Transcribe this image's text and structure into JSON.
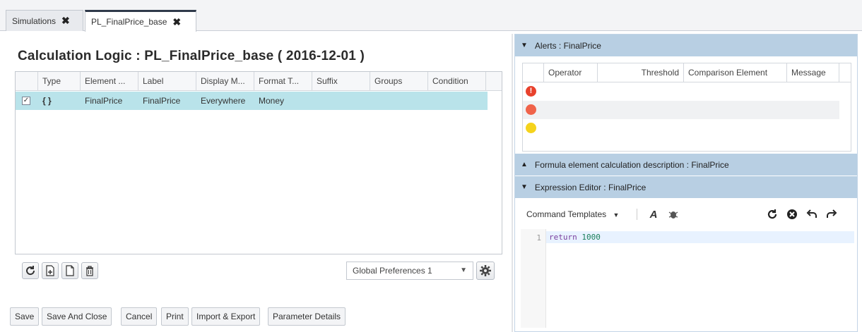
{
  "tabs": [
    {
      "label": "Simulations",
      "close": "✖"
    },
    {
      "label": "PL_FinalPrice_base",
      "close": "✖"
    }
  ],
  "left": {
    "title": "Calculation Logic : PL_FinalPrice_base ( 2016-12-01 )",
    "columns": [
      "Type",
      "Element ...",
      "Label",
      "Display M...",
      "Format T...",
      "Suffix",
      "Groups",
      "Condition"
    ],
    "row": {
      "checked": "✓",
      "type": "{ }",
      "element": "FinalPrice",
      "label": "FinalPrice",
      "display": "Everywhere",
      "format": "Money"
    },
    "preferences_select": "Global Preferences 1",
    "buttons": [
      "Save",
      "Save And Close",
      "Cancel",
      "Print",
      "Import & Export",
      "Parameter Details"
    ]
  },
  "right": {
    "alerts_title": "Alerts : FinalPrice",
    "alerts_columns": [
      "Operator",
      "Threshold",
      "Comparison Element",
      "Message"
    ],
    "alert_levels": [
      {
        "name": "critical",
        "color": "#e8412c",
        "symbol": "!"
      },
      {
        "name": "error",
        "color": "#f0634a",
        "symbol": ""
      },
      {
        "name": "warning",
        "color": "#f5d31c",
        "symbol": ""
      }
    ],
    "formula_title": "Formula element calculation description : FinalPrice",
    "expression_title": "Expression Editor : FinalPrice",
    "command_templates": "Command Templates",
    "code": {
      "line_number": "1",
      "keyword": "return",
      "value": "1000"
    }
  },
  "colors": {
    "panel_header": "#b8cfe3",
    "row_selected": "#b9e3ea",
    "active_tab_border": "#2f3a4a"
  }
}
